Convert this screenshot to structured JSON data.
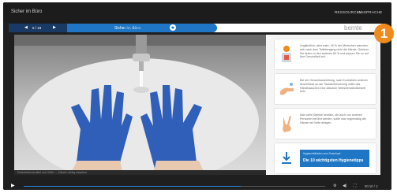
{
  "app": {
    "title": "Sicher im Büro"
  },
  "top_links": [
    "RESSOURCEN",
    "ANSPRACHE"
  ],
  "step_bar": {
    "prev": "◀",
    "counter": "5 / 18",
    "next": "▶",
    "title": "Sicher im Büro",
    "topic": "Handhygiene",
    "brand": "bernte"
  },
  "video": {
    "caption": "Desinfektionsmittel und Seife — Hände richtig waschen"
  },
  "cards": [
    {
      "icon": "person-icon",
      "text": "Ungläublich, aber wahr: 40 % der Menschen waschen sich nach dem Toilettengang nicht die Hände. Gehören Sie lieber zu den anderen 60 % und passen Sie so auf Ihre Gesundheit auf."
    },
    {
      "icon": "hand-wash-icon",
      "text": "Bei der Gesamtausbreitung, nach Kontrakten anderen Anschlüsse an der Tastaturbenutzung sollte das Händewaschen eine absolute Selbstverständlichkeit sein."
    },
    {
      "icon": "peace-hand-icon",
      "text": "Man sieht Objekte deutlich, die auch von anderen Personen berührt werden, sollte man regelmäßig die Hände mit Seife reinigen."
    },
    {
      "icon": "download-icon",
      "small": "Hygieneleitfaden zum Download",
      "title": "Die 10 wichtigsten Hygienetipps"
    }
  ],
  "controls": {
    "play": "▶",
    "time": "00:10 / 1:",
    "progress": 0.72
  },
  "badge": {
    "number": "1"
  },
  "colors": {
    "accent": "#1f76c4",
    "navy": "#1a3a66",
    "badge": "#f08a1c",
    "glove": "#2f5fb8"
  }
}
